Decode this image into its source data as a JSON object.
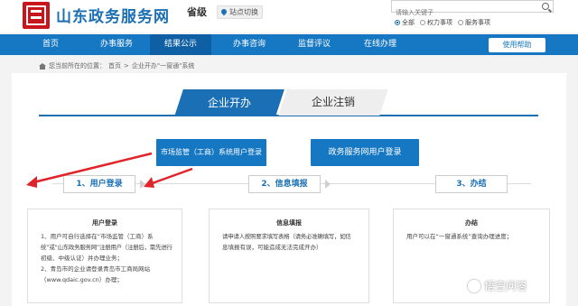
{
  "header": {
    "site_title": "山东政务服务网",
    "level": "省级",
    "station_switch": "站点切换",
    "search_placeholder": "请输入关键子",
    "radio_options": [
      "全部",
      "权力事项",
      "服务事项"
    ],
    "selected_radio": "全部"
  },
  "nav": {
    "items": [
      "首页",
      "办事服务",
      "结果公示",
      "办事咨询",
      "监督评议",
      "在线办理"
    ],
    "active": "结果公示",
    "help": "使用帮助"
  },
  "breadcrumb": {
    "prefix": "您当前所在的位置：",
    "home": "首页",
    "sep": ">",
    "current": "企业开办\"一窗通\"系统"
  },
  "tabs": {
    "open": "企业开办",
    "close": "企业注销"
  },
  "login_buttons": {
    "market": "市场监管（工商）系统用户登录",
    "gov": "政务服务网用户登录"
  },
  "steps": [
    {
      "label": "1、用户登录"
    },
    {
      "label": "2、信息填报"
    },
    {
      "label": "3、办结"
    }
  ],
  "cards": [
    {
      "title": "用户登录",
      "lines": [
        "1、用户可自行选择在“市场监管（工商）系",
        "统”或“山东政务服务网”注册用户（注册后，需先进行",
        "初级、中级认证）并办理业务；",
        "2、青岛市的企业请登录青岛市工商局网站",
        "（www.qdaic.gov.cn）办理；"
      ]
    },
    {
      "title": "信息填报",
      "lines": [
        "请申请人按照要求填写表格（请务必准确填写，如信",
        "息填报有误，可能造成无法完成开办）"
      ]
    },
    {
      "title": "办结",
      "lines": [
        "用户可以在“一窗通系统”查询办理进度；"
      ]
    }
  ],
  "watermark": "悟空问答",
  "colors": {
    "primary": "#1677c2",
    "title_blue": "#1a6fb5",
    "annotation_red": "#e0242b"
  }
}
